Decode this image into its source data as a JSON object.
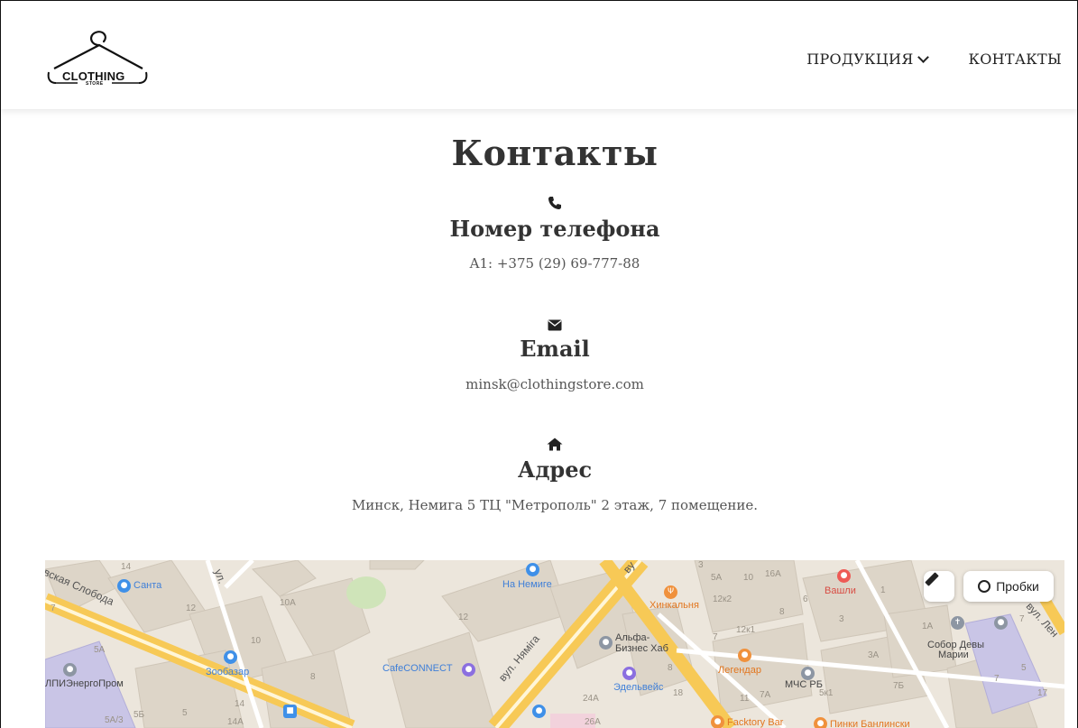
{
  "logo": {
    "text": "CLOTHING",
    "sub": "STORE"
  },
  "nav": [
    {
      "label": "ПРОДУКЦИЯ",
      "icon": "chevron-down-icon"
    },
    {
      "label": "КОНТАКТЫ"
    }
  ],
  "page": {
    "title": "Контакты"
  },
  "phone": {
    "icon": "phone-icon",
    "title": "Номер телефона",
    "value": "A1: +375 (29) 69-777-88"
  },
  "email": {
    "icon": "envelope-icon",
    "title": "Email",
    "value": "minsk@clothingstore.com"
  },
  "address": {
    "icon": "home-icon",
    "title": "Адрес",
    "value": "Минск, Немига 5 ТЦ \"Метрополь\" 2 этаж, 7 помещение."
  },
  "map": {
    "traffic_button": "Пробки",
    "ruler_icon": "ruler-icon",
    "places": {
      "santa": "Санта",
      "na_nemige": "На Немиге",
      "khinkalnya": "Хинкальня",
      "vashli": "Вашли",
      "alfa": "Альфа-",
      "alfa2": "Бизнес Хаб",
      "cafeconnect": "CafeCONNECT",
      "zoobazar": "Зообазар",
      "edelveys": "Эдельвейс",
      "legendar": "Легендар",
      "mchs": "МЧС РБ",
      "sobor": "Собор Девы",
      "sobor2": "Марии",
      "energoprom": "ЛПИЭнергоПром",
      "facktory": "Facktory Bar",
      "pinki": "Пинки Банлински"
    },
    "streets": {
      "sloboda": "вская Слобода",
      "nyamiga": "вул. Няміга",
      "len": "вул. Лен",
      "ul": "ул.",
      "vu": "ву"
    },
    "numbers": {
      "n14": "14",
      "n12": "12",
      "n10a": "10А",
      "n12b": "12",
      "n10": "10",
      "n8": "8",
      "n7": "7",
      "n5a": "5А",
      "n5": "5",
      "n5a3": "5А/3",
      "n5b": "5Б",
      "n14b": "14",
      "n14a": "14А",
      "n3": "3",
      "n5a2": "5А",
      "n10b": "10",
      "n16a": "16А",
      "n12k2": "12к2",
      "n6": "6",
      "n1": "1",
      "n12k1": "12к1",
      "n8b": "8",
      "n3b": "3",
      "n7b": "7",
      "n8c": "8",
      "n18": "18",
      "n24a": "24А",
      "n26a": "26А",
      "n11": "11",
      "n7a": "7А",
      "n5k1": "5к1",
      "n3a": "3А",
      "n1a": "1А",
      "n7c": "7",
      "n7d": "7Б",
      "n5c": "5",
      "n17": "17",
      "n7e": "7"
    }
  }
}
